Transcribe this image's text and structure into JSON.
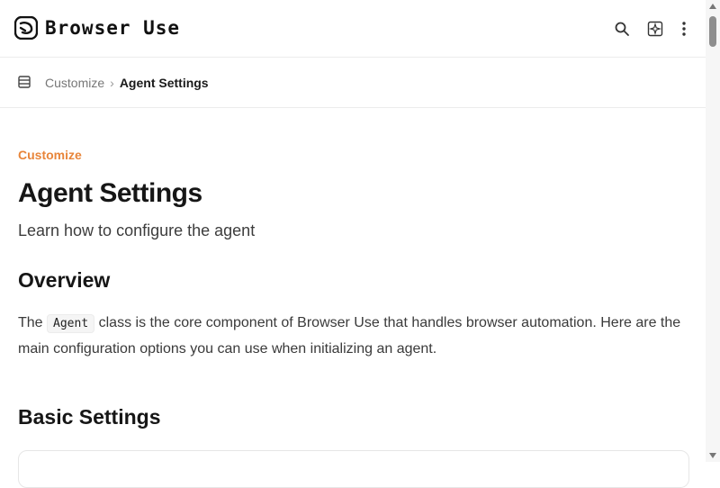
{
  "header": {
    "logo_text": "Browser Use",
    "icons": [
      "search-icon",
      "sparkle-icon",
      "more-vertical-icon"
    ]
  },
  "breadcrumb": {
    "parent": "Customize",
    "separator": "›",
    "current": "Agent Settings"
  },
  "page": {
    "eyebrow": "Customize",
    "title": "Agent Settings",
    "subtitle": "Learn how to configure the agent"
  },
  "sections": {
    "overview_heading": "Overview",
    "overview_text_before": "The",
    "overview_code": "Agent",
    "overview_text_after": "class is the core component of Browser Use that handles browser automation. Here are the main configuration options you can use when initializing an agent.",
    "basic_heading": "Basic Settings"
  },
  "colors": {
    "accent": "#e8853a"
  }
}
